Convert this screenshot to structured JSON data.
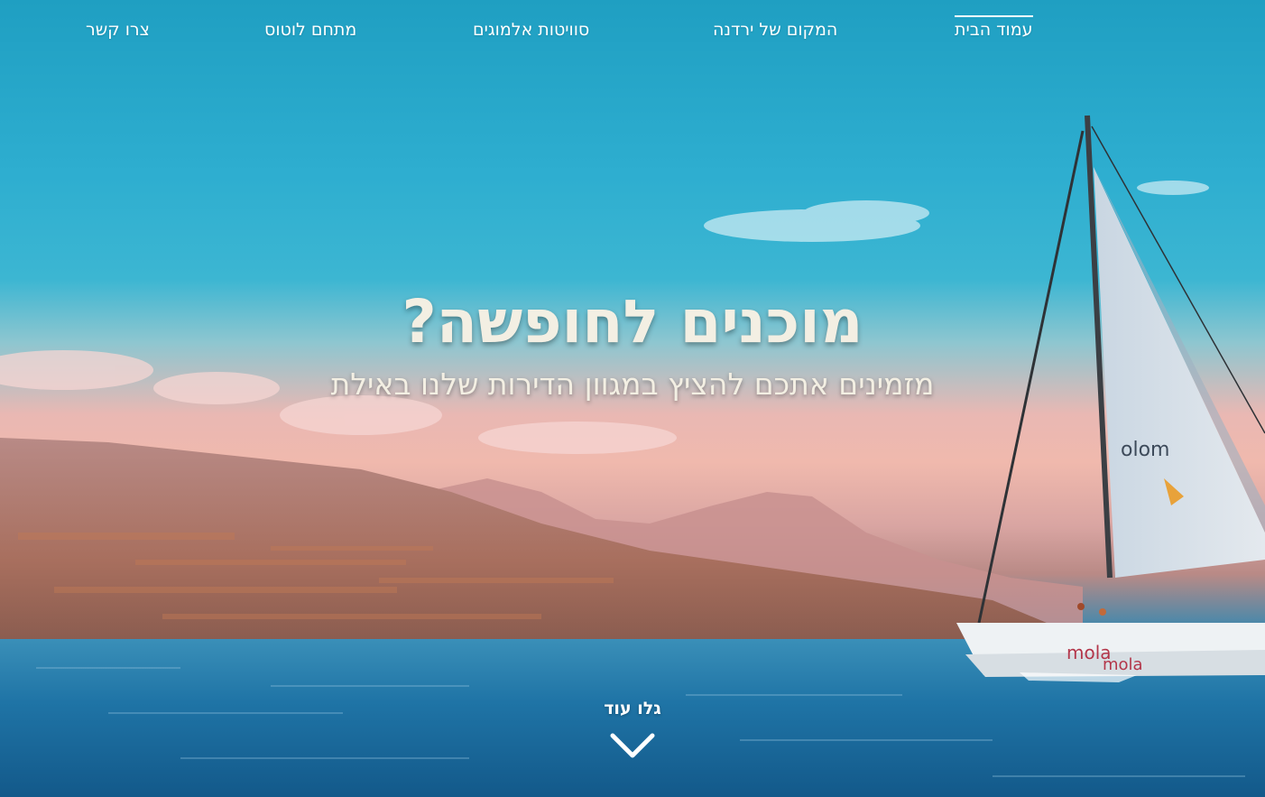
{
  "nav": {
    "items": [
      {
        "label": "עמוד הבית",
        "active": true
      },
      {
        "label": "המקום של ירדנה",
        "active": false
      },
      {
        "label": "סוויטות אלמוגים",
        "active": false
      },
      {
        "label": "מתחם לוטוס",
        "active": false
      },
      {
        "label": "צרו קשר",
        "active": false
      }
    ]
  },
  "hero": {
    "title": "מוכנים לחופשה?",
    "subtitle": "מזמינים אתכם להציץ במגוון הדירות שלנו באילת",
    "cta_label": "גלו עוד",
    "cta_icon": "chevron-down-icon",
    "boat_hull_text_1": "mola",
    "boat_hull_text_2": "mola",
    "sail_text": "olom"
  },
  "colors": {
    "nav_text": "#ffffff",
    "headline_text": "#f3efe3",
    "sky": "#2eaed0",
    "haze": "#f0b9ad",
    "sea": "#1c6fa0"
  }
}
